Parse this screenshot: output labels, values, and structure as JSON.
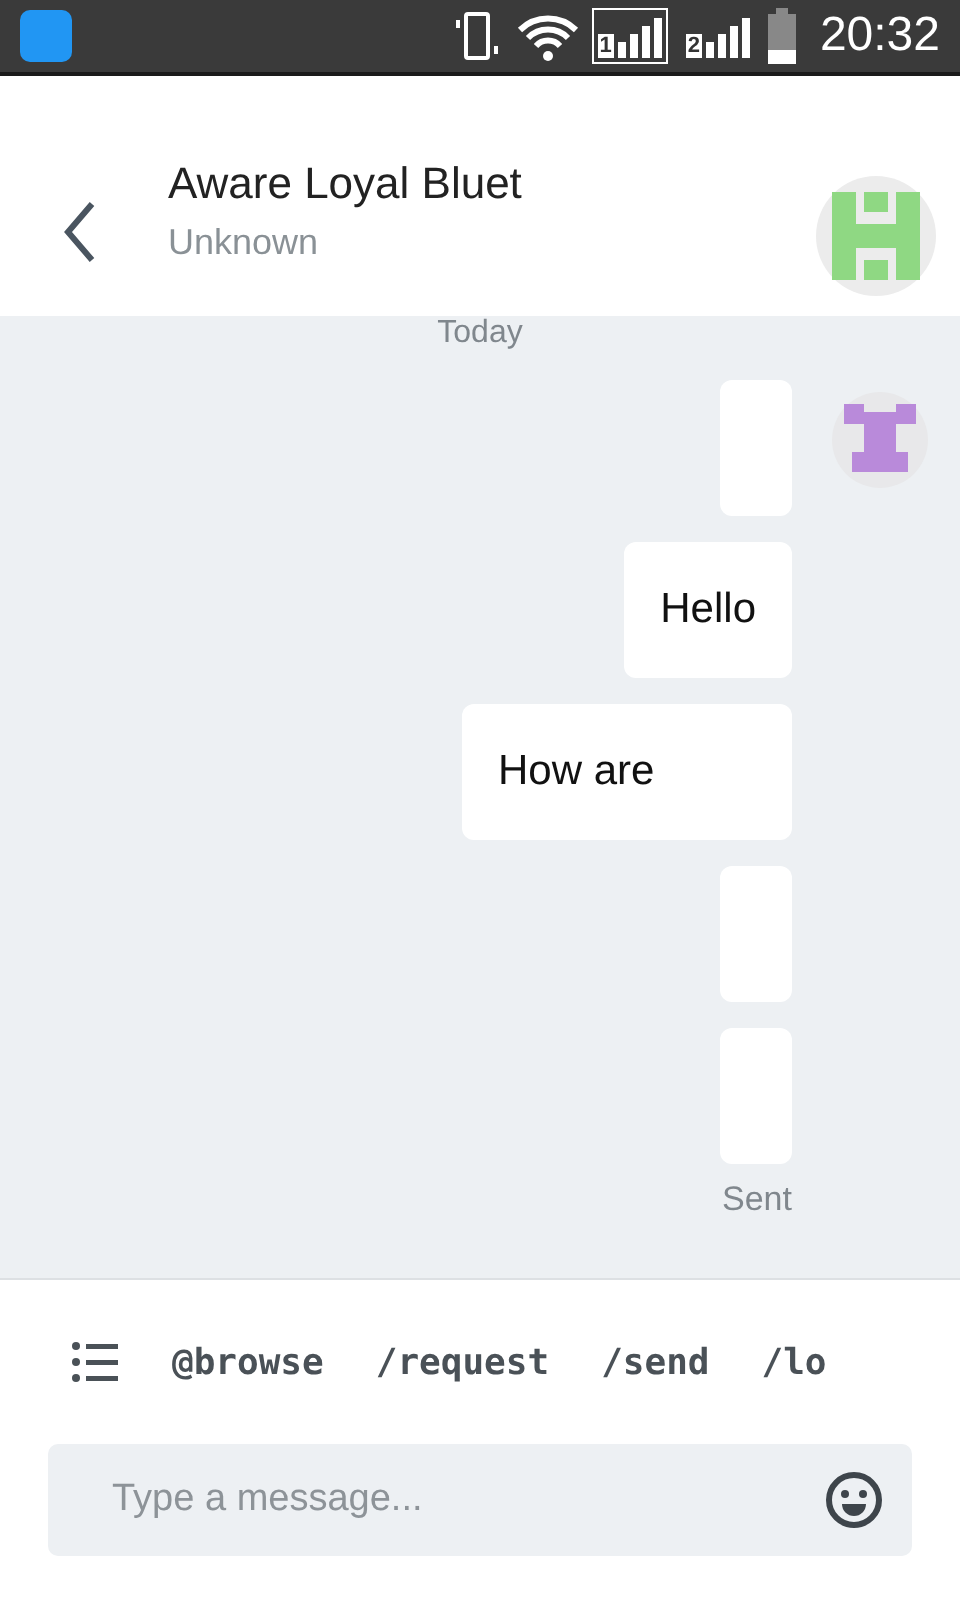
{
  "status_bar": {
    "sims": [
      {
        "label": "1",
        "selected": true
      },
      {
        "label": "2",
        "selected": false
      }
    ],
    "time": "20:32"
  },
  "header": {
    "title": "Aware Loyal Bluet",
    "subtitle": "Unknown"
  },
  "chat": {
    "date": "Today",
    "messages": [
      {
        "kind": "empty"
      },
      {
        "kind": "text",
        "text": "Hello"
      },
      {
        "kind": "text",
        "text": "How are"
      },
      {
        "kind": "empty"
      },
      {
        "kind": "empty"
      }
    ],
    "status": "Sent"
  },
  "commands": [
    "@browse",
    "/request",
    "/send",
    "/lo"
  ],
  "composer": {
    "placeholder": "Type a message..."
  }
}
